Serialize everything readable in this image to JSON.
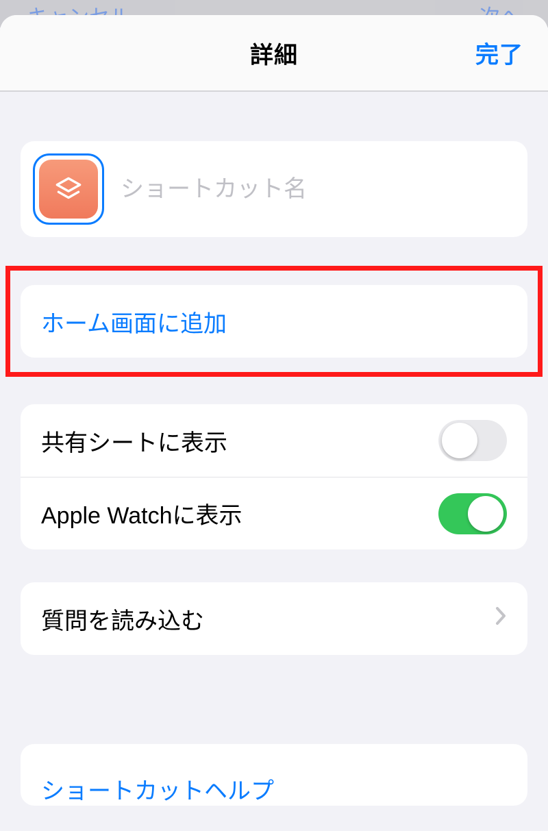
{
  "bg": {
    "cancel": "キャンセル",
    "next": "次へ"
  },
  "navbar": {
    "title": "詳細",
    "done": "完了"
  },
  "name": {
    "placeholder": "ショートカット名",
    "value": ""
  },
  "actions": {
    "add_to_home": "ホーム画面に追加"
  },
  "toggles": {
    "share_sheet": {
      "label": "共有シートに表示",
      "on": false
    },
    "apple_watch": {
      "label": "Apple Watchに表示",
      "on": true
    }
  },
  "questions": {
    "label": "質問を読み込む"
  },
  "help": {
    "label": "ショートカットヘルプ"
  },
  "colors": {
    "accent": "#0a7cff",
    "icon_tile_top": "#f79a7a",
    "icon_tile_bottom": "#f07a5c",
    "toggle_on": "#34c759",
    "highlight": "#ff1a1a"
  },
  "icons": {
    "shortcut": "stack-icon",
    "chevron": "chevron-right-icon"
  }
}
